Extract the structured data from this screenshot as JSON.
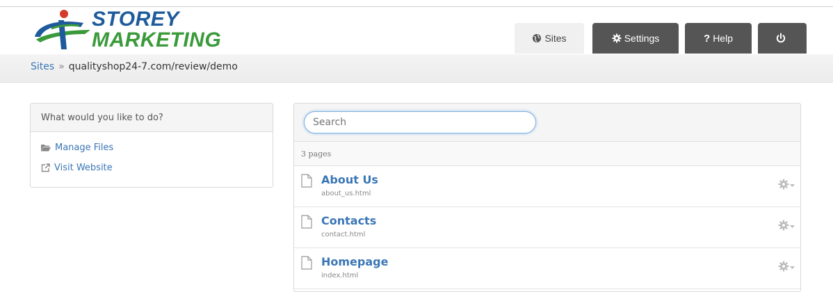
{
  "logo": {
    "line1": "STOREY",
    "line2": "MARKETING"
  },
  "tabs": [
    {
      "label": "Sites",
      "icon": "globe-icon"
    },
    {
      "label": "Settings",
      "icon": "gear-icon"
    },
    {
      "label": "Help",
      "icon": "question-icon"
    },
    {
      "label": "",
      "icon": "power-icon"
    }
  ],
  "breadcrumb": {
    "root": "Sites",
    "separator": "»",
    "current": "qualityshop24-7.com/review/demo"
  },
  "actions_panel": {
    "heading": "What would you like to do?",
    "items": [
      {
        "label": "Manage Files",
        "icon": "folder-icon"
      },
      {
        "label": "Visit Website",
        "icon": "external-link-icon"
      }
    ]
  },
  "pages_panel": {
    "search": {
      "placeholder": "Search",
      "value": ""
    },
    "count_label": "3 pages",
    "pages": [
      {
        "title": "About Us",
        "file": "about_us.html"
      },
      {
        "title": "Contacts",
        "file": "contact.html"
      },
      {
        "title": "Homepage",
        "file": "index.html"
      }
    ]
  },
  "colors": {
    "link": "#3a76b5",
    "tab_dark": "#555555",
    "logo_blue": "#1f5b9c",
    "logo_green": "#3a9a3a",
    "logo_red": "#d43b2a"
  }
}
